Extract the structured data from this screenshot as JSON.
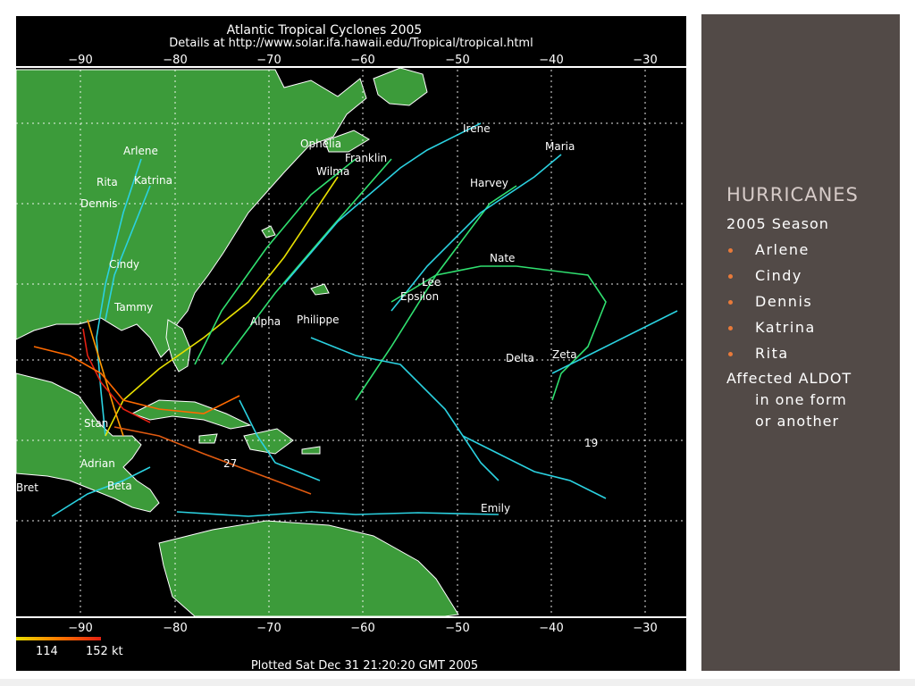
{
  "map": {
    "title": "Atlantic Tropical Cyclones 2005",
    "details": "Details at http://www.solar.ifa.hawaii.edu/Tropical/tropical.html",
    "lon_ticks": [
      "−90",
      "−80",
      "−70",
      "−60",
      "−50",
      "−40",
      "−30"
    ],
    "legend_min": "114",
    "legend_max": "152 kt",
    "plotted": "Plotted Sat Dec 31 21:20:20 GMT 2005",
    "storm_labels": [
      "Arlene",
      "Rita",
      "Katrina",
      "Dennis",
      "Cindy",
      "Tammy",
      "Ophelia",
      "Franklin",
      "Wilma",
      "Irene",
      "Maria",
      "Harvey",
      "Nate",
      "Lee",
      "Epsilon",
      "Alpha",
      "Philippe",
      "Delta",
      "Zeta",
      "Stan",
      "Emily",
      "Beta",
      "Adrian",
      "Bret",
      "19",
      "27"
    ],
    "colors": {
      "land": "#3c9b3a",
      "ocean": "#000000",
      "grid": "#ffffff",
      "track_weak": "#2bd1e0",
      "track_strong": "#e32012"
    }
  },
  "panel": {
    "title": "HURRICANES",
    "subtitle": "2005 Season",
    "items": [
      "Arlene",
      "Cindy",
      "Dennis",
      "Katrina",
      "Rita"
    ],
    "note_line1": "Affected ALDOT",
    "note_line2": "in one form",
    "note_line3": "or another",
    "colors": {
      "background": "#524a47",
      "title": "#d6cbc8",
      "bullet": "#e87a3a"
    }
  }
}
